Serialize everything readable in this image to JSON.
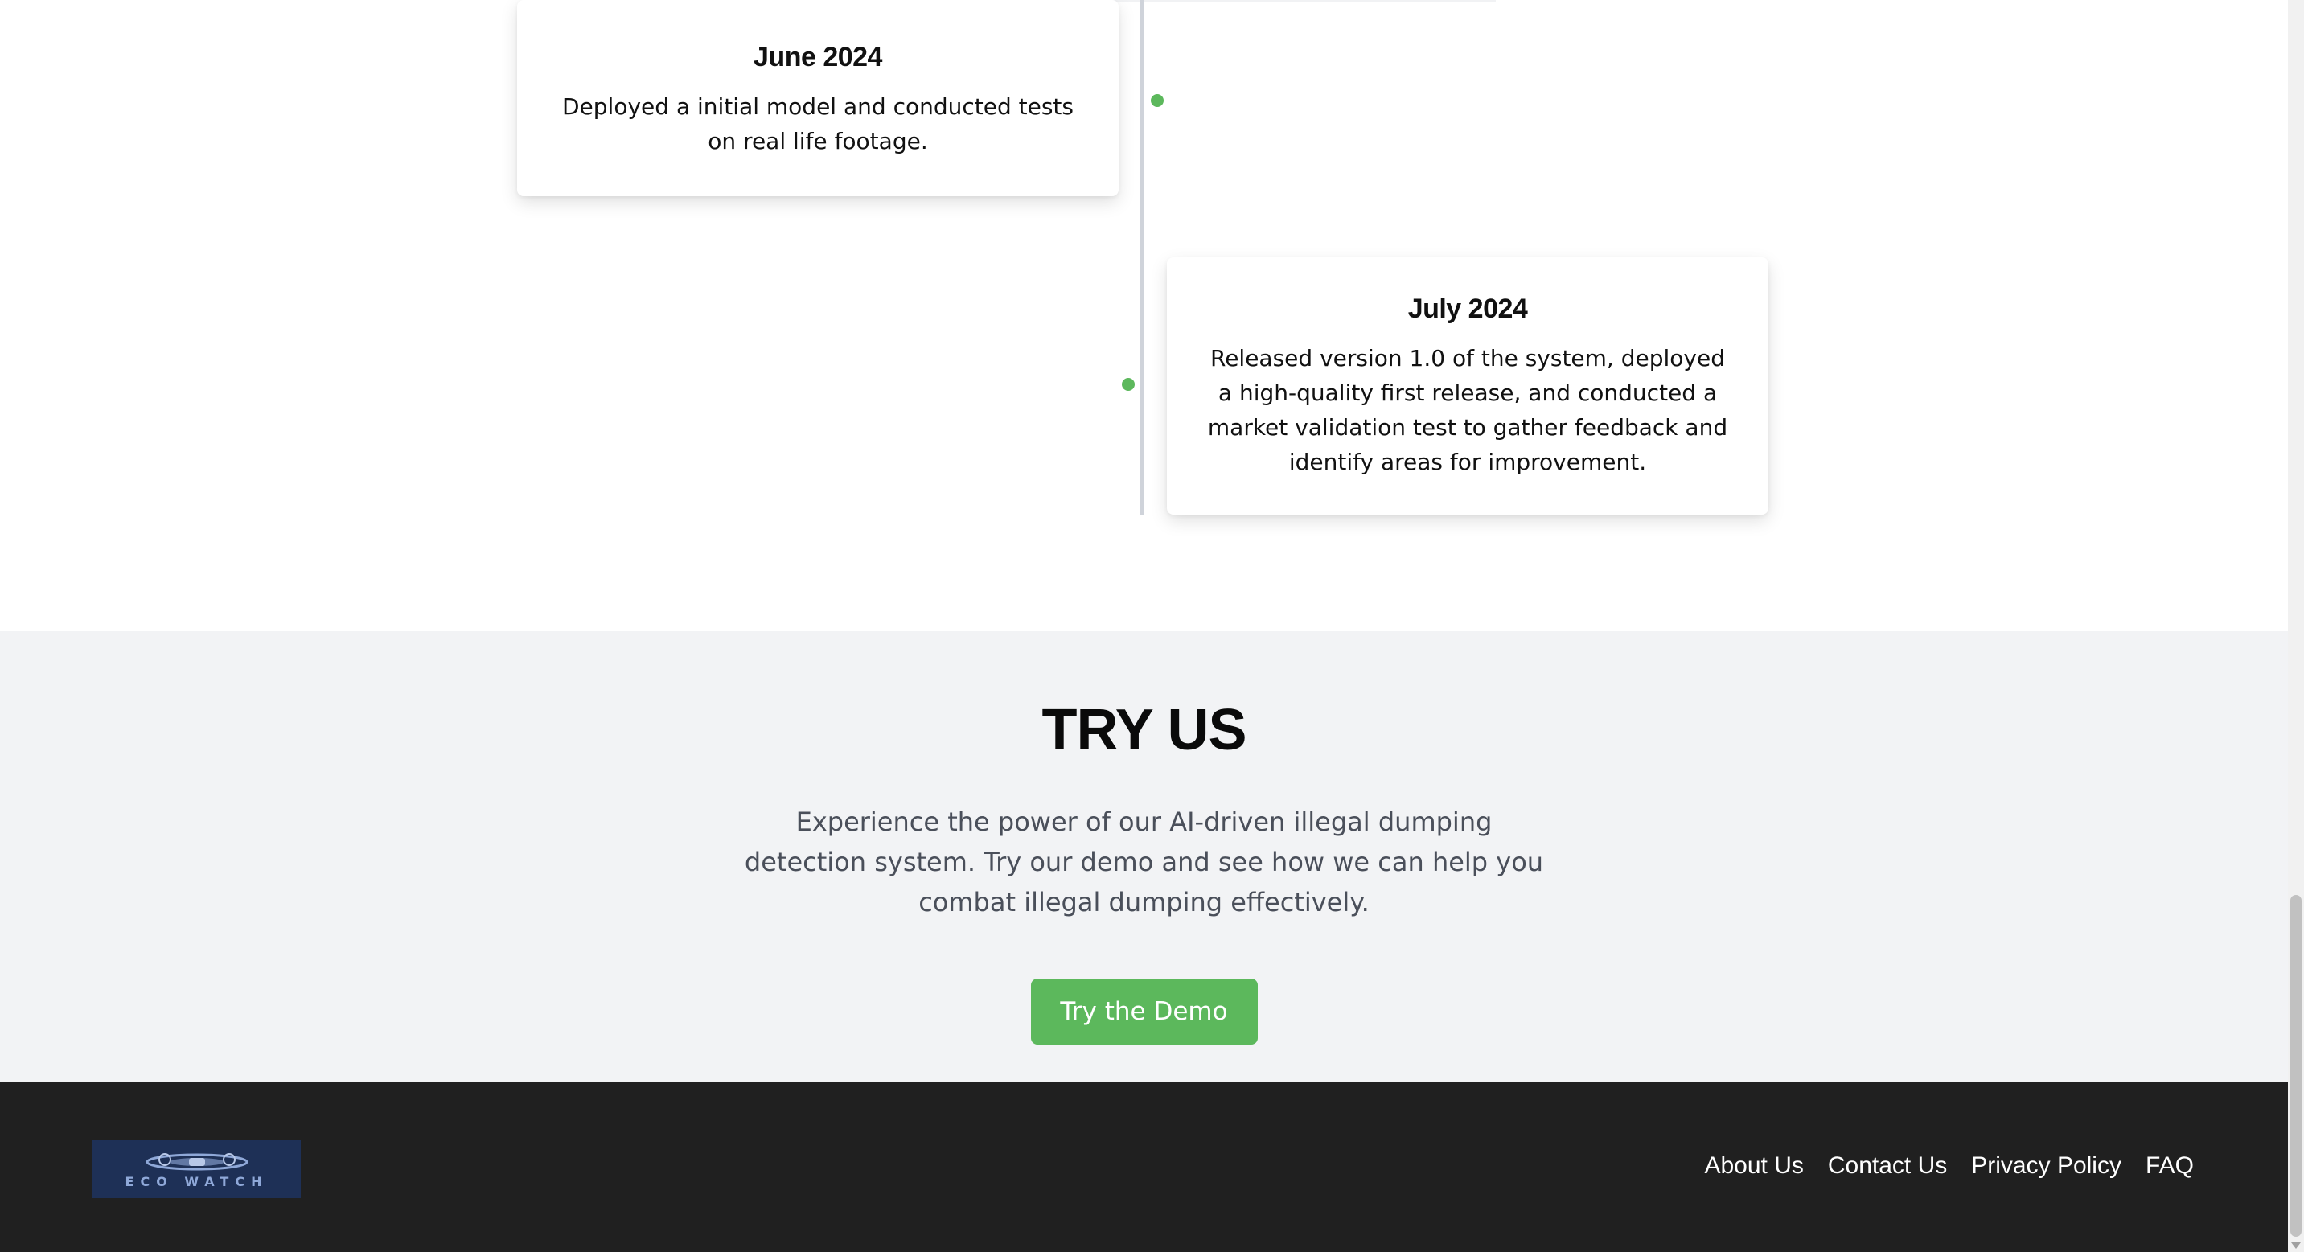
{
  "timeline": {
    "items": [
      {
        "date": "June 2024",
        "description": "Deployed a initial model and conducted tests on real life footage."
      },
      {
        "date": "July 2024",
        "description": "Released version 1.0 of the system, deployed a high-quality first release, and conducted a market validation test to gather feedback and identify areas for improvement."
      }
    ],
    "dot_color": "#5cb85c"
  },
  "try_section": {
    "title": "TRY US",
    "description": "Experience the power of our AI-driven illegal dumping detection system. Try our demo and see how we can help you combat illegal dumping effectively.",
    "button_label": "Try the Demo",
    "button_color": "#5cb85c"
  },
  "footer": {
    "logo_text": "ECO WATCH",
    "logo_icon": "drone-icon",
    "links": [
      "About Us",
      "Contact Us",
      "Privacy Policy",
      "FAQ"
    ]
  }
}
